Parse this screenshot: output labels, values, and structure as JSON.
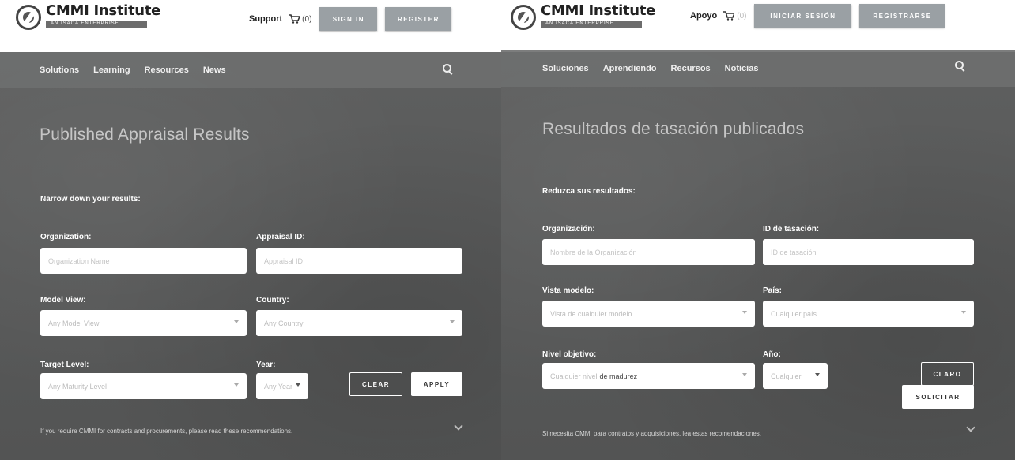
{
  "english": {
    "logo": {
      "name": "CMMI Institute",
      "tagline": "AN ISACA ENTERPRISE"
    },
    "utility": {
      "support": "Support",
      "cart_count": "(0)",
      "sign_in": "SIGN IN",
      "register": "REGISTER"
    },
    "nav": {
      "items": [
        "Solutions",
        "Learning",
        "Resources",
        "News"
      ]
    },
    "title": "Published Appraisal Results",
    "narrow": "Narrow down your results:",
    "form": {
      "organization_label": "Organization:",
      "organization_placeholder": "Organization Name",
      "appraisal_id_label": "Appraisal ID:",
      "appraisal_id_placeholder": "Appraisal ID",
      "model_view_label": "Model View:",
      "model_view_value": "Any Model View",
      "country_label": "Country:",
      "country_value": "Any Country",
      "target_level_label": "Target Level:",
      "target_level_value": "Any Maturity Level",
      "year_label": "Year:",
      "year_value": "Any Year",
      "clear": "CLEAR",
      "apply": "APPLY"
    },
    "note": "If you require CMMI for contracts and procurements, please read these recommendations."
  },
  "spanish": {
    "logo": {
      "name": "CMMI Institute",
      "tagline": "AN ISACA ENTERPRISE"
    },
    "utility": {
      "support": "Apoyo",
      "cart_count": "(0)",
      "sign_in": "INICIAR SESIÓN",
      "register": "REGISTRARSE"
    },
    "nav": {
      "items": [
        "Soluciones",
        "Aprendiendo",
        "Recursos",
        "Noticias"
      ]
    },
    "title": "Resultados de tasación publicados",
    "narrow": "Reduzca sus resultados:",
    "form": {
      "organization_label": "Organización:",
      "organization_placeholder": "Nombre de la Organización",
      "appraisal_id_label": "ID de tasación:",
      "appraisal_id_placeholder": "ID de tasación",
      "model_view_label": "Vista modelo:",
      "model_view_value": "Vista de cualquier modelo",
      "country_label": "País:",
      "country_value": "Cualquier país",
      "target_level_label": "Nivel objetivo:",
      "target_level_value_light": "Cualquier nivel ",
      "target_level_value_dark": "de madurez",
      "year_label": "Año:",
      "year_value": "Cualquier",
      "clear": "CLARO",
      "apply": "SOLICITAR"
    },
    "note": "Si necesita CMMI para contratos y adquisiciones, lea estas recomendaciones."
  },
  "colors": {
    "hero_bg": "#595a5a",
    "nav_bg": "#6e6f6f",
    "top_button": "#9aa0a4",
    "title": "#c6c6c6"
  }
}
